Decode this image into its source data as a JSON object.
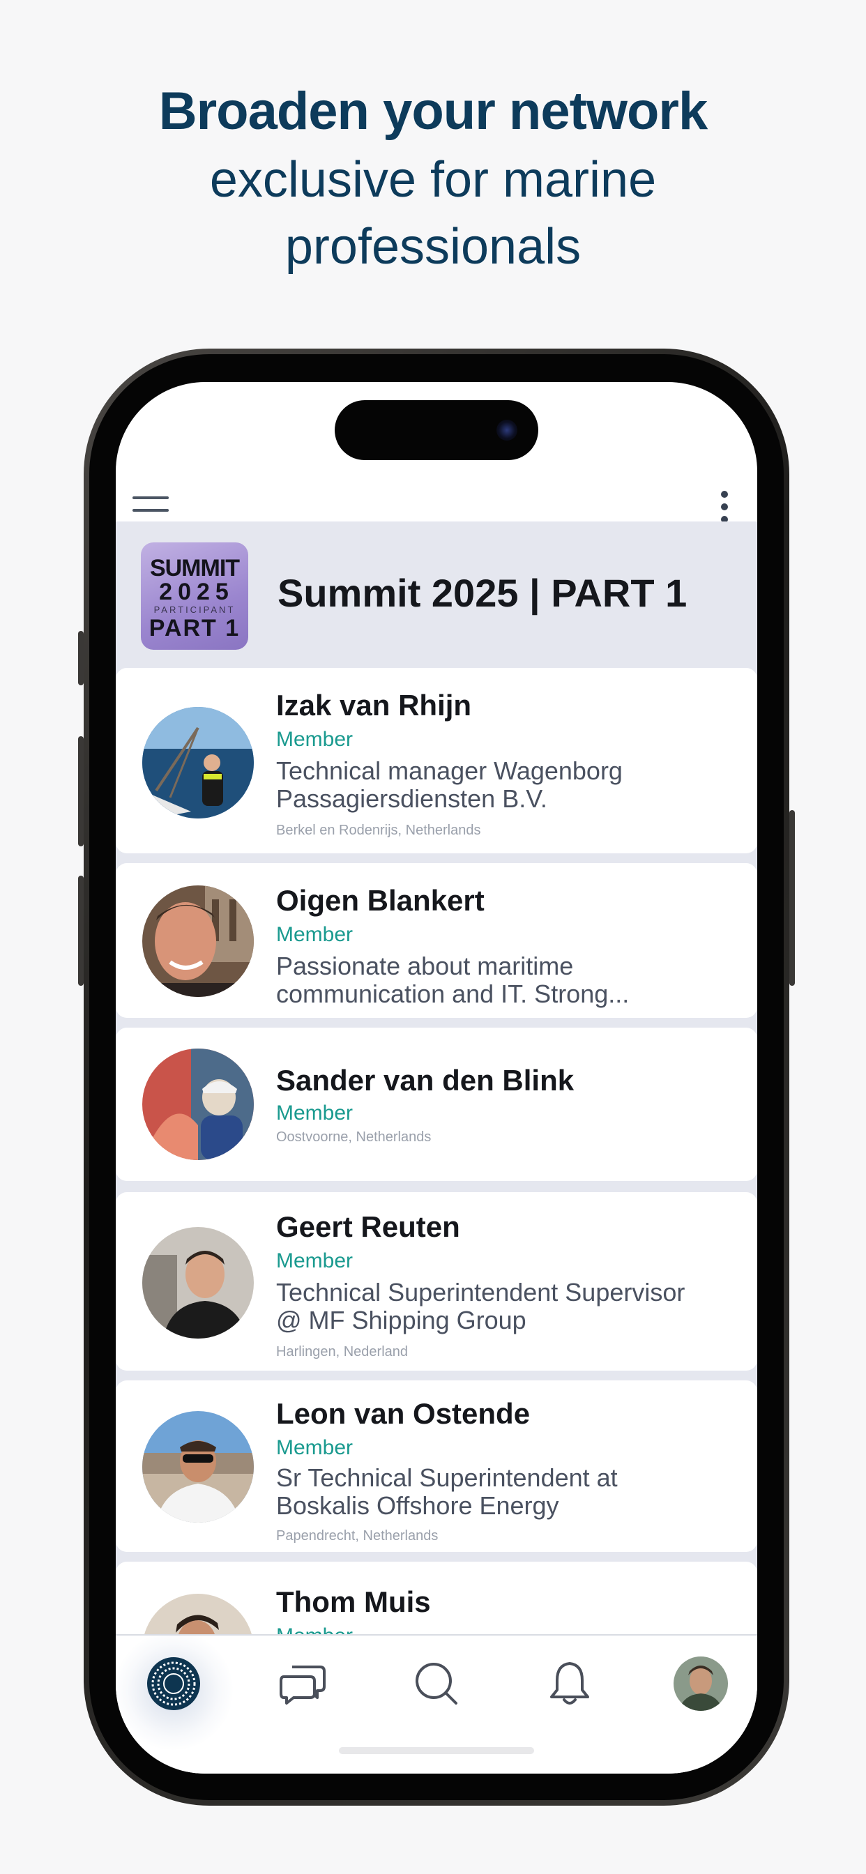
{
  "promo": {
    "headline": "Broaden your network",
    "subline_1": "exclusive for marine",
    "subline_2": "professionals"
  },
  "group": {
    "logo_line_1": "SUMMIT",
    "logo_line_2": "2025",
    "logo_line_3": "PARTICIPANT",
    "logo_line_4": "PART 1",
    "title": "Summit 2025 | PART 1"
  },
  "members": [
    {
      "name": "Izak van Rhijn",
      "role": "Member",
      "bio_1": "Technical manager Wagenborg",
      "bio_2": "Passagiersdiensten B.V.",
      "location": "Berkel en Rodenrijs, Netherlands"
    },
    {
      "name": "Oigen Blankert",
      "role": "Member",
      "bio_1": "Passionate about maritime",
      "bio_2": "communication and IT. Strong...",
      "location": ""
    },
    {
      "name": "Sander van den Blink",
      "role": "Member",
      "bio_1": "",
      "bio_2": "",
      "location": "Oostvoorne, Netherlands"
    },
    {
      "name": "Geert Reuten",
      "role": "Member",
      "bio_1": "Technical Superintendent Supervisor",
      "bio_2": "@ MF Shipping Group",
      "location": "Harlingen, Nederland"
    },
    {
      "name": "Leon van Ostende",
      "role": "Member",
      "bio_1": "Sr Technical Superintendent at",
      "bio_2": "Boskalis Offshore Energy",
      "location": "Papendrecht, Netherlands"
    },
    {
      "name": "Thom Muis",
      "role": "Member",
      "bio_1": "",
      "bio_2": "",
      "location": ""
    }
  ],
  "tabbar": {
    "items": [
      "home-icon",
      "chat-icon",
      "search-icon",
      "bell-icon",
      "profile-avatar"
    ]
  },
  "colors": {
    "headline": "#0d3b5b",
    "accent_teal": "#1a9a8f",
    "list_background": "#e5e7ef"
  }
}
